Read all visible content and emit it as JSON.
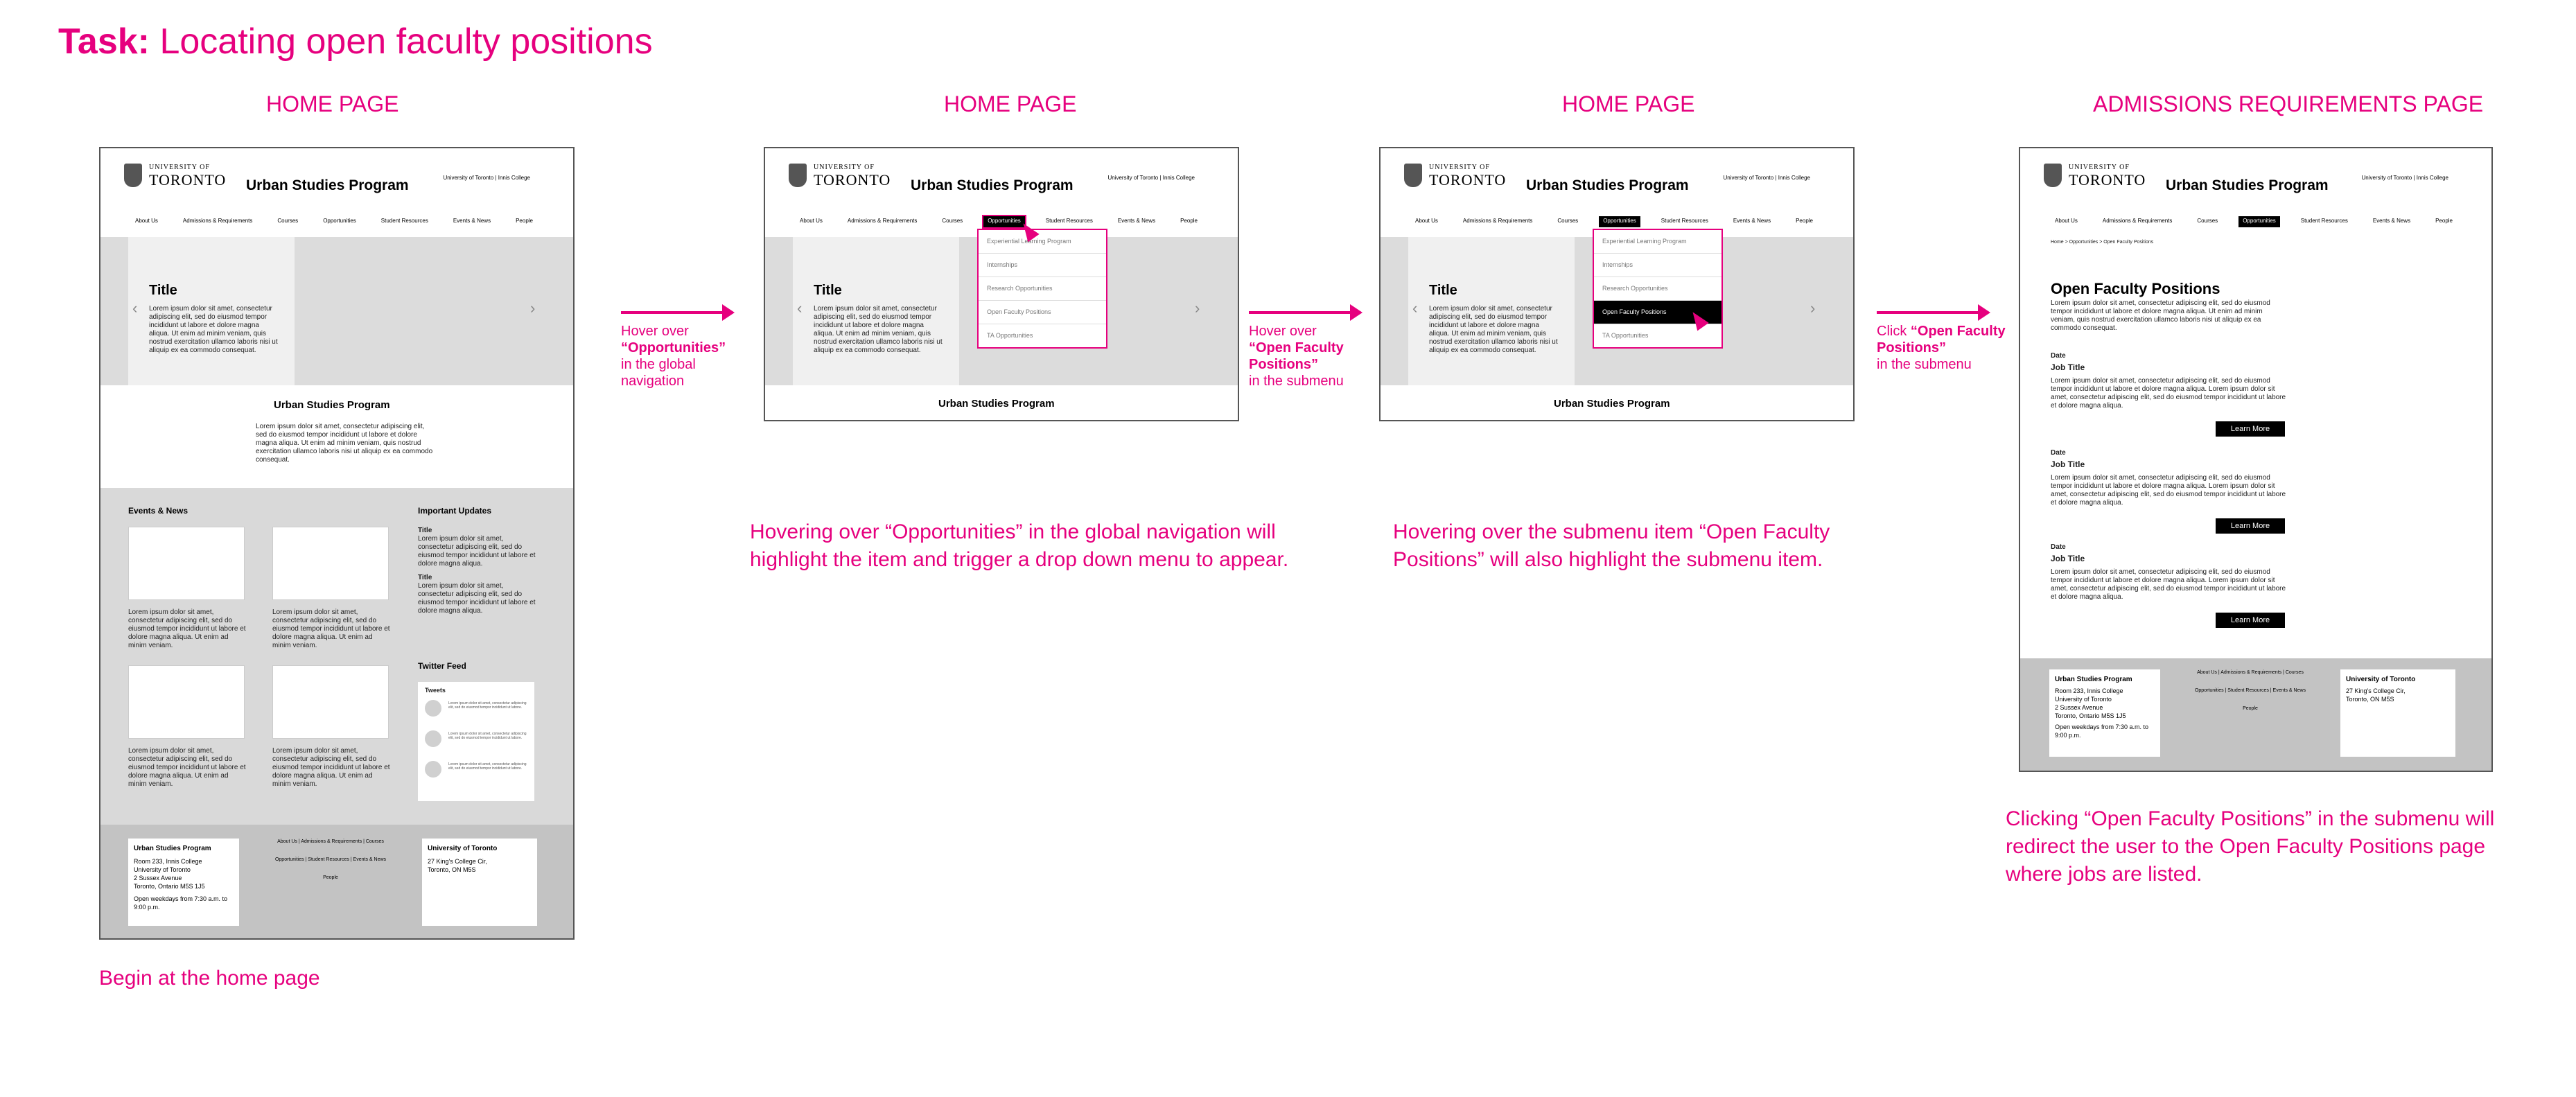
{
  "task": {
    "prefix": "Task:",
    "title": "Locating open faculty positions"
  },
  "labels": {
    "home1": "HOME PAGE",
    "home2": "HOME PAGE",
    "home3": "HOME PAGE",
    "admissions": "ADMISSIONS REQUIREMENTS PAGE"
  },
  "site": {
    "uoft_small": "UNIVERSITY OF",
    "uoft_big": "TORONTO",
    "program": "Urban Studies Program",
    "top_links": "University of Toronto  |  Innis College",
    "nav": [
      "About Us",
      "Admissions & Requirements",
      "Courses",
      "Opportunities",
      "Student Resources",
      "Events & News",
      "People"
    ],
    "hero_title": "Title",
    "hero_text": "Lorem ipsum dolor sit amet, consectetur adipiscing elit, sed do eiusmod tempor incididunt ut labore et dolore magna aliqua. Ut enim ad minim veniam, quis nostrud exercitation ullamco laboris nisi ut aliquip ex ea commodo consequat.",
    "intro_title": "Urban Studies Program",
    "intro_text": "Lorem ipsum dolor sit amet, consectetur adipiscing elit, sed do eiusmod tempor incididunt ut labore et dolore magna aliqua. Ut enim ad minim veniam, quis nostrud exercitation ullamco laboris nisi ut aliquip ex ea commodo consequat.",
    "events_title": "Events & News",
    "events_text": "Lorem ipsum dolor sit amet, consectetur adipiscing elit, sed do eiusmod tempor incididunt ut labore et dolore magna aliqua. Ut enim ad minim veniam.",
    "updates_title": "Important Updates",
    "update_item_title": "Title",
    "update_item_text": "Lorem ipsum dolor sit amet, consectetur adipiscing elit, sed do eiusmod tempor incididunt ut labore et dolore magna aliqua.",
    "twitter_title": "Twitter Feed",
    "tweets_label": "Tweets",
    "tweet_text": "Lorem ipsum dolor sit amet, consectetur adipiscing elit, sed do eiusmod tempor incididunt ut labore.",
    "submenu": [
      "Experiential Learning Program",
      "Internships",
      "Research Opportunities",
      "Open Faculty Positions",
      "TA Opportunities"
    ],
    "footer": {
      "left_title": "Urban Studies Program",
      "left_address": "Room 233, Innis College\nUniversity of Toronto\n2 Sussex Avenue\nToronto, Ontario M5S 1J5",
      "left_hours": "Open weekdays from 7:30 a.m. to 9:00 p.m.",
      "links_row1": "About Us  |  Admissions & Requirements  |  Courses",
      "links_row2": "Opportunities  |  Student Resources  |  Events & News",
      "links_row3": "People",
      "right_title": "University of Toronto",
      "right_address": "27 King's College Cir,\nToronto, ON M5S"
    }
  },
  "faculty_page": {
    "breadcrumb": "Home > Opportunities > Open Faculty Positions",
    "title": "Open Faculty Positions",
    "intro": "Lorem ipsum dolor sit amet, consectetur adipiscing elit, sed do eiusmod tempor incididunt ut labore et dolore magna aliqua. Ut enim ad minim veniam, quis nostrud exercitation ullamco laboris nisi ut aliquip ex ea commodo consequat.",
    "jobs": [
      {
        "date": "Date",
        "title": "Job Title",
        "text": "Lorem ipsum dolor sit amet, consectetur adipiscing elit, sed do eiusmod tempor incididunt ut labore et dolore magna aliqua. Lorem ipsum dolor sit amet, consectetur adipiscing elit, sed do eiusmod tempor incididunt ut labore et dolore magna aliqua.",
        "button": "Learn More"
      },
      {
        "date": "Date",
        "title": "Job Title",
        "text": "Lorem ipsum dolor sit amet, consectetur adipiscing elit, sed do eiusmod tempor incididunt ut labore et dolore magna aliqua. Lorem ipsum dolor sit amet, consectetur adipiscing elit, sed do eiusmod tempor incididunt ut labore et dolore magna aliqua.",
        "button": "Learn More"
      },
      {
        "date": "Date",
        "title": "Job Title",
        "text": "Lorem ipsum dolor sit amet, consectetur adipiscing elit, sed do eiusmod tempor incididunt ut labore et dolore magna aliqua. Lorem ipsum dolor sit amet, consectetur adipiscing elit, sed do eiusmod tempor incididunt ut labore et dolore magna aliqua.",
        "button": "Learn More"
      }
    ]
  },
  "steps": {
    "step1_pre": "Hover over",
    "step1_bold": "“Opportunities”",
    "step1_post": "in the global navigation",
    "step2_pre": "Hover over",
    "step2_bold": "“Open Faculty Positions”",
    "step2_post": "in the submenu",
    "step3_pre": "Click",
    "step3_bold": "“Open Faculty Positions”",
    "step3_post": "in the submenu"
  },
  "captions": {
    "begin": "Begin at the home page",
    "hover_opps": "Hovering over “Opportunities” in the global navigation will highlight the item and trigger a drop down menu to appear.",
    "hover_submenu": "Hovering over the submenu item “Open Faculty Positions” will also highlight the submenu item.",
    "click": "Clicking “Open Faculty Positions” in the submenu will redirect the user to the Open Faculty Positions page where jobs are listed."
  },
  "colors": {
    "accent": "#e6007e",
    "frame_gray": "#dcdcdc",
    "footer_gray": "#c3c3c3"
  }
}
